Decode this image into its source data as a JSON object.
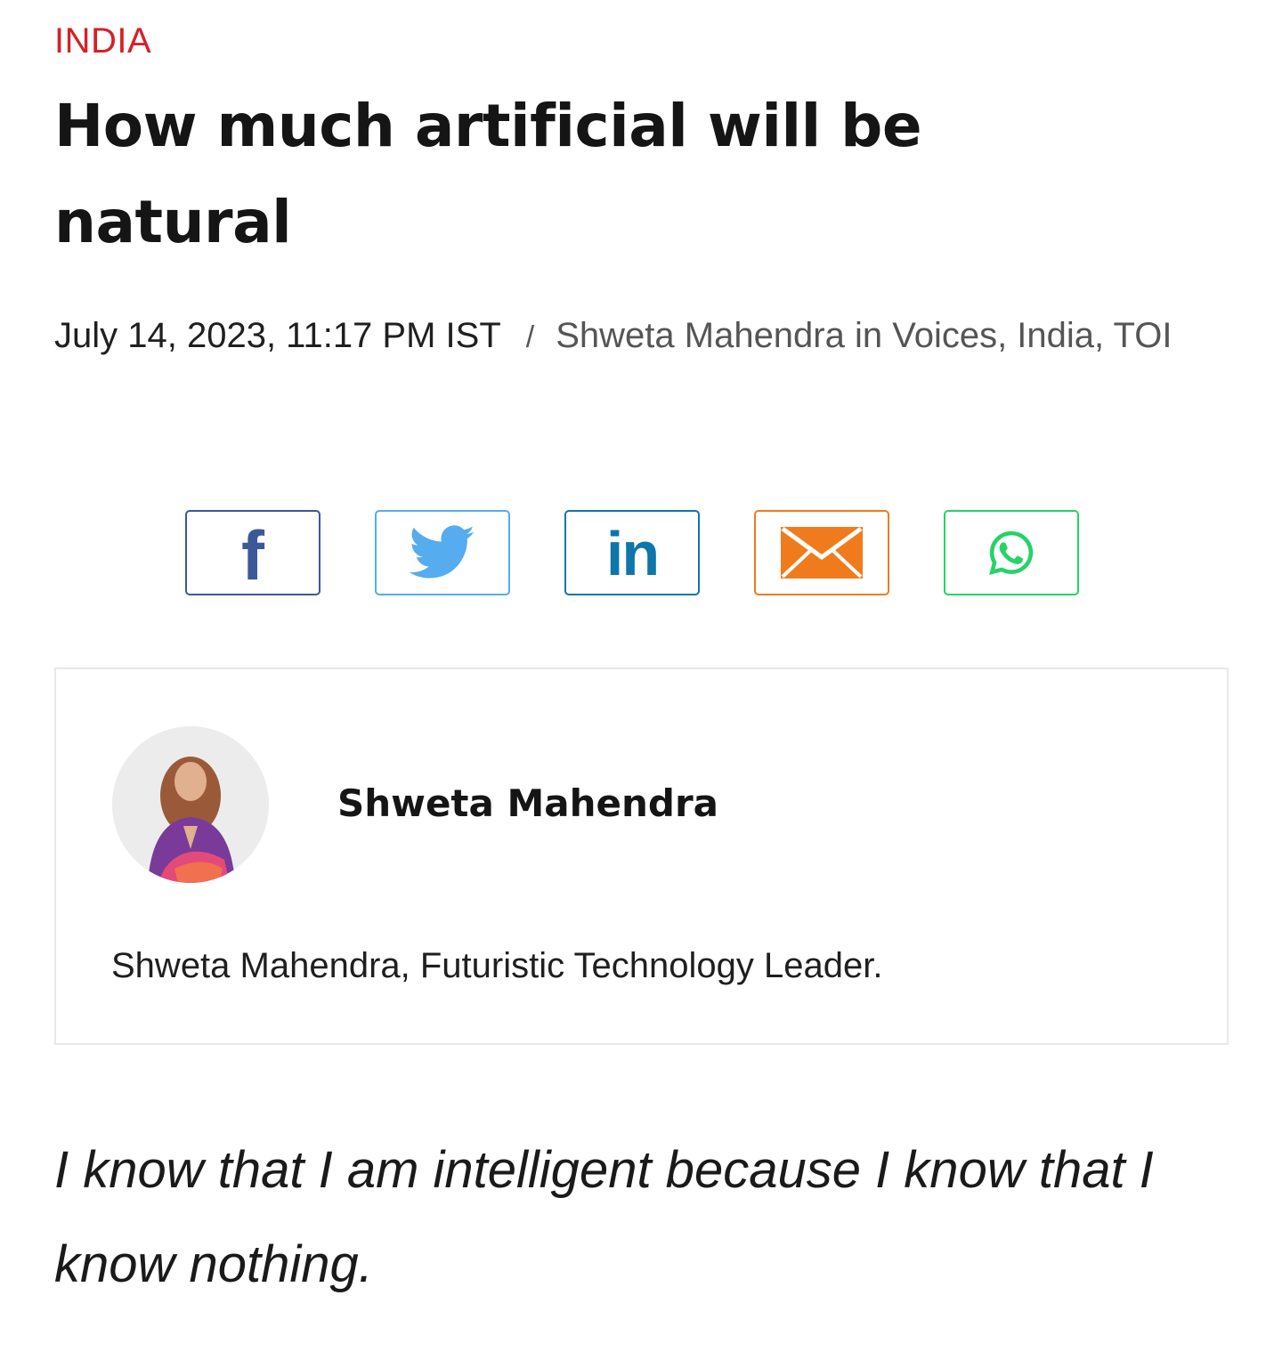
{
  "article": {
    "category": "INDIA",
    "headline": "How much artificial will be natural",
    "datetime": "July 14, 2023, 11:17 PM IST",
    "separator": "/",
    "byline": "Shweta Mahendra in Voices, India, TOI",
    "quote": " I know that I am intelligent because I know that I know nothing."
  },
  "share": {
    "buttons": [
      {
        "icon": "facebook-icon",
        "glyph": "f",
        "color": "#3b5998"
      },
      {
        "icon": "twitter-icon",
        "color": "#55acee"
      },
      {
        "icon": "linkedin-icon",
        "glyph": "in",
        "color": "#0e76a8"
      },
      {
        "icon": "email-icon",
        "color": "#f07b1c"
      },
      {
        "icon": "whatsapp-icon",
        "color": "#25d366"
      }
    ]
  },
  "author_card": {
    "name": "Shweta Mahendra",
    "bio": "Shweta Mahendra, Futuristic Technology Leader."
  },
  "colors": {
    "category": "#d62027",
    "text": "#1a1a1a",
    "muted": "#555555"
  }
}
